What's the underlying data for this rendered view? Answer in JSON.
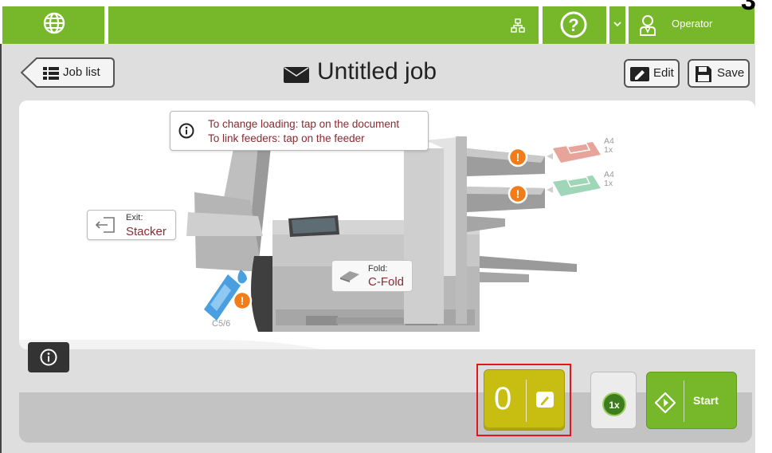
{
  "topbar": {
    "operator_label": "Operator",
    "corner_mark": "3",
    "icons": [
      "globe-icon",
      "network-icon",
      "help-icon",
      "chevron-down-icon",
      "operator-icon"
    ]
  },
  "header": {
    "job_list_label": "Job list",
    "title": "Untitled job",
    "edit_label": "Edit",
    "save_label": "Save"
  },
  "hint": {
    "line1": "To change loading: tap on the document",
    "line2": "To link feeders: tap on the feeder"
  },
  "exit": {
    "label": "Exit:",
    "value": "Stacker"
  },
  "fold": {
    "label": "Fold:",
    "value": "C-Fold"
  },
  "feeders": [
    {
      "paper": "A4",
      "count": "1x",
      "color": "#e6a49a"
    },
    {
      "paper": "A4",
      "count": "1x",
      "color": "#9fd6b8"
    }
  ],
  "envelope": {
    "size": "C5/6",
    "color": "#4a9fe0"
  },
  "counter": {
    "value": "0"
  },
  "copies": {
    "label": "1x"
  },
  "start": {
    "label": "Start"
  },
  "colors": {
    "brand_green": "#76b82a",
    "counter_yellow": "#c8be12",
    "warning_orange": "#f07d19",
    "text_accent": "#8a2b31",
    "highlight_red": "#e3141b"
  }
}
